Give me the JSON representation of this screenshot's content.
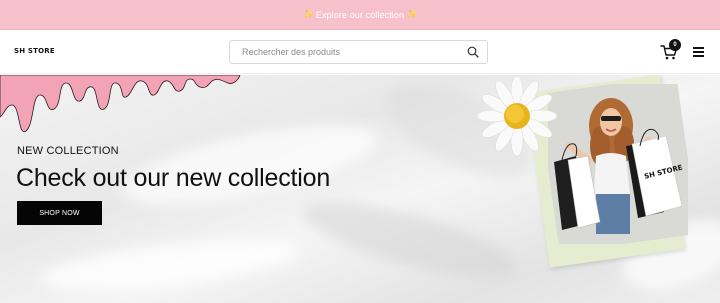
{
  "announcement": {
    "text": "Explore our collection",
    "spark_left": "✨",
    "spark_right": "✨"
  },
  "header": {
    "logo": "SH STORE",
    "search_placeholder": "Rechercher des produits",
    "cart_count": "0"
  },
  "hero": {
    "subtitle": "NEW COLLECTION",
    "title": "Check out our new collection",
    "button_label": "SHOP NOW",
    "bag_logo": "SH STORE"
  },
  "colors": {
    "announcement_bg": "#f6c1cb",
    "drip_pink": "#f2a3b6",
    "button_bg": "#050505"
  },
  "icons": [
    "search-icon",
    "cart-icon",
    "menu-icon",
    "sparkle-icon"
  ]
}
